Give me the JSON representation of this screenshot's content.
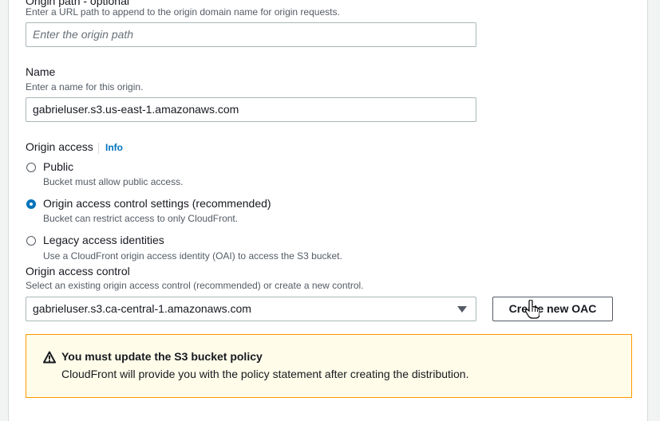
{
  "origin_path": {
    "label": "Origin path - optional",
    "description": "Enter a URL path to append to the origin domain name for origin requests.",
    "placeholder": "Enter the origin path"
  },
  "name": {
    "label": "Name",
    "description": "Enter a name for this origin.",
    "value": "gabrieluser.s3.us-east-1.amazonaws.com"
  },
  "origin_access": {
    "label": "Origin access",
    "info": "Info",
    "options": [
      {
        "label": "Public",
        "description": "Bucket must allow public access.",
        "checked": false
      },
      {
        "label": "Origin access control settings (recommended)",
        "description": "Bucket can restrict access to only CloudFront.",
        "checked": true
      },
      {
        "label": "Legacy access identities",
        "description": "Use a CloudFront origin access identity (OAI) to access the S3 bucket.",
        "checked": false
      }
    ]
  },
  "oac": {
    "label": "Origin access control",
    "description": "Select an existing origin access control (recommended) or create a new control.",
    "selected": "gabrieluser.s3.ca-central-1.amazonaws.com",
    "create_button": "Create new OAC"
  },
  "alert": {
    "title": "You must update the S3 bucket policy",
    "body": "CloudFront will provide you with the policy statement after creating the distribution."
  }
}
